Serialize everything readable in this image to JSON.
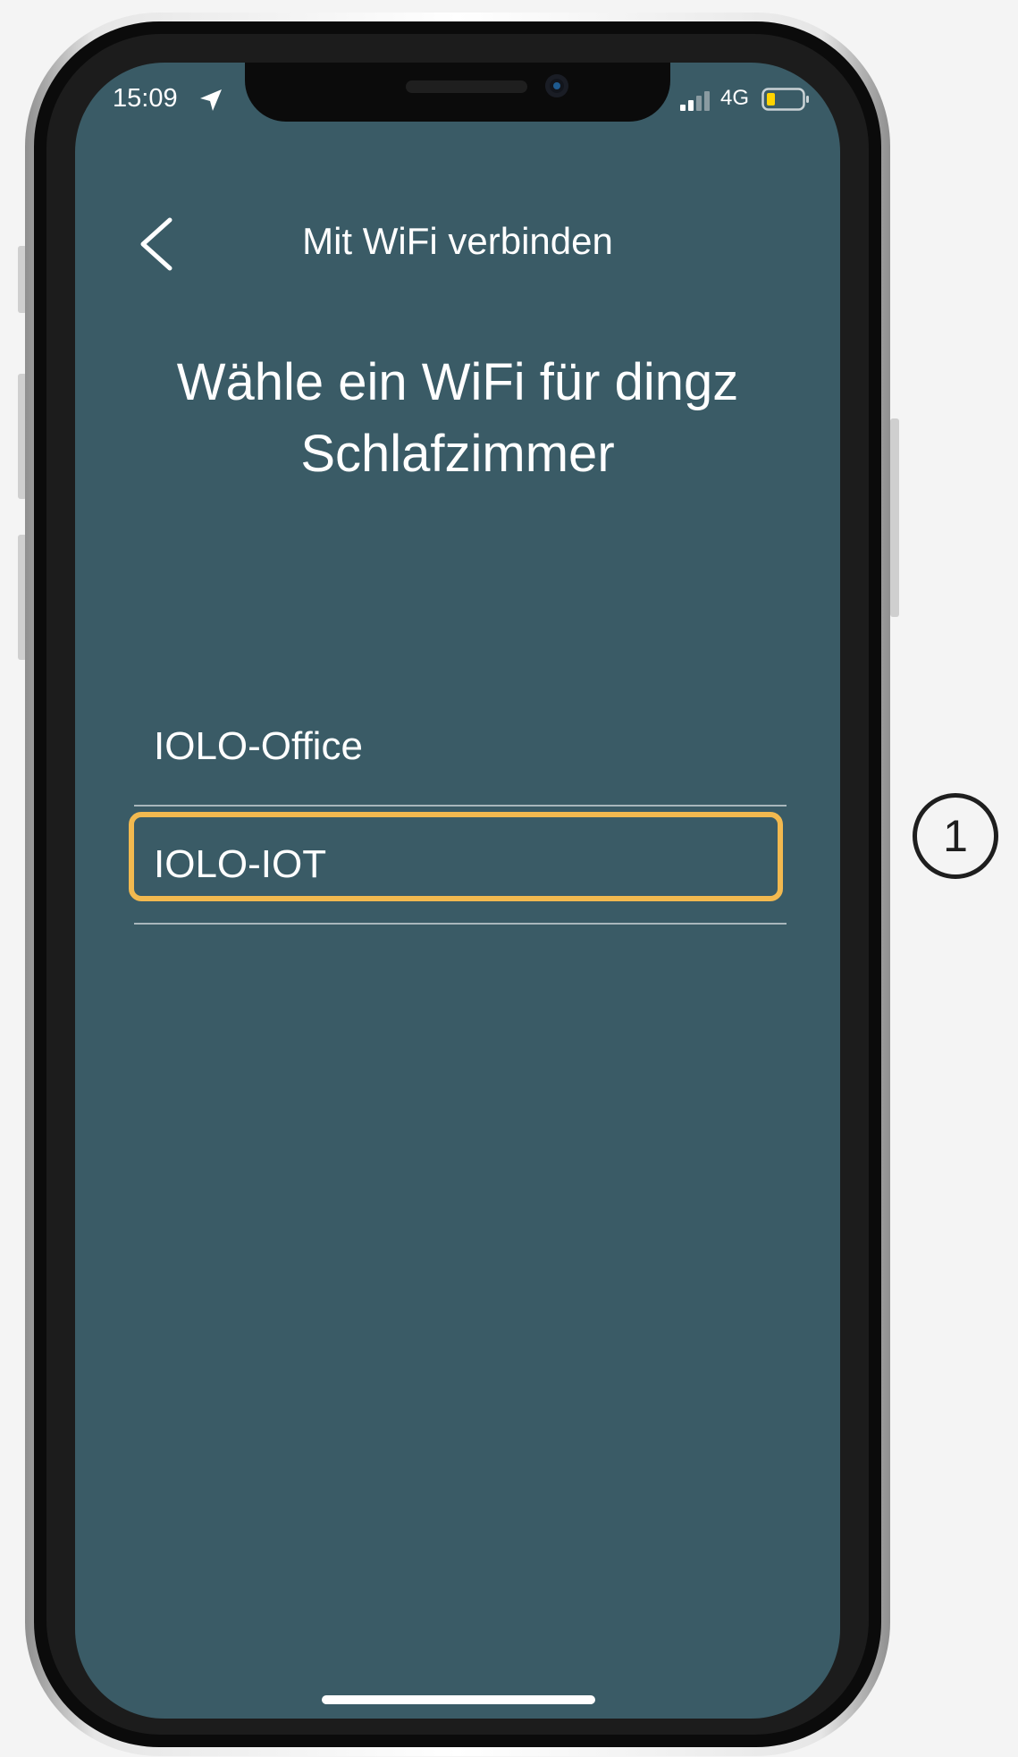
{
  "status_bar": {
    "time": "15:09",
    "network": "4G",
    "location_icon": "location-arrow-icon",
    "signal_icon": "cellular-signal-icon",
    "battery_icon": "battery-low-icon",
    "battery_color": "#ffd400"
  },
  "nav": {
    "back_icon": "chevron-left-icon",
    "title": "Mit WiFi verbinden"
  },
  "heading": {
    "line1": "Wähle ein WiFi für dingz",
    "line2": "Schlafzimmer"
  },
  "wifi_networks": [
    {
      "label": "IOLO-Office",
      "highlighted": false
    },
    {
      "label": "IOLO-IOT",
      "highlighted": true
    }
  ],
  "annotation": {
    "step_number": "1",
    "highlight_color": "#f2b94f"
  },
  "colors": {
    "screen_background": "#3a5b66",
    "text": "#ffffff"
  }
}
